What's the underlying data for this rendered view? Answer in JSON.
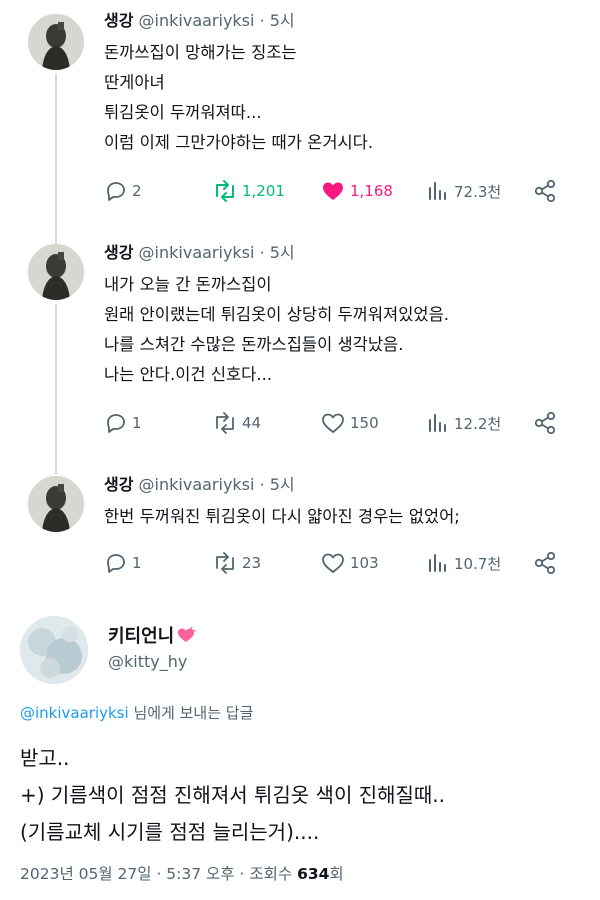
{
  "thread": [
    {
      "name": "생강",
      "handle": "@inkivaariyksi",
      "dot": "·",
      "time": "5시",
      "text": "돈까쓰집이 망해가는 징조는\n딴게아녀\n튀김옷이 두꺼워져따...\n이럼 이제 그만가야하는 때가 온거시다.",
      "stats": {
        "replies": "2",
        "retweets": "1,201",
        "likes": "1,168",
        "views": "72.3천"
      },
      "liked": true,
      "retweeted": true
    },
    {
      "name": "생강",
      "handle": "@inkivaariyksi",
      "dot": "·",
      "time": "5시",
      "text": "내가 오늘 간 돈까스집이\n원래 안이랬는데 튀김옷이 상당히 두꺼워져있었음.\n나를 스쳐간 수많은 돈까스집들이 생각났음.\n나는 안다.이건 신호다...",
      "stats": {
        "replies": "1",
        "retweets": "44",
        "likes": "150",
        "views": "12.2천"
      },
      "liked": false,
      "retweeted": false
    },
    {
      "name": "생강",
      "handle": "@inkivaariyksi",
      "dot": "·",
      "time": "5시",
      "text": "한번 두꺼워진 튀김옷이 다시 얇아진 경우는 없었어;",
      "stats": {
        "replies": "1",
        "retweets": "23",
        "likes": "103",
        "views": "10.7천"
      },
      "liked": false,
      "retweeted": false
    }
  ],
  "main": {
    "name": "키티언니",
    "handle": "@kitty_hy",
    "reply_mention": "@inkivaariyksi",
    "reply_suffix": " 님에게 보내는 답글",
    "text": "받고..\n+) 기름색이 점점 진해져서 튀김옷 색이 진해질때..\n(기름교체 시기를 점점 늘리는거)....",
    "date": "2023년 05월 27일 · 5:37 오후 · 조회수 ",
    "views": "634",
    "views_suffix": "회"
  },
  "colors": {
    "text": "#0f1419",
    "secondary": "#536471",
    "retweet": "#00ba7c",
    "like": "#f91880",
    "link": "#1d9bf0"
  },
  "icons": [
    "reply-icon",
    "retweet-icon",
    "like-icon",
    "views-icon",
    "share-icon",
    "heart-emoji-icon"
  ]
}
